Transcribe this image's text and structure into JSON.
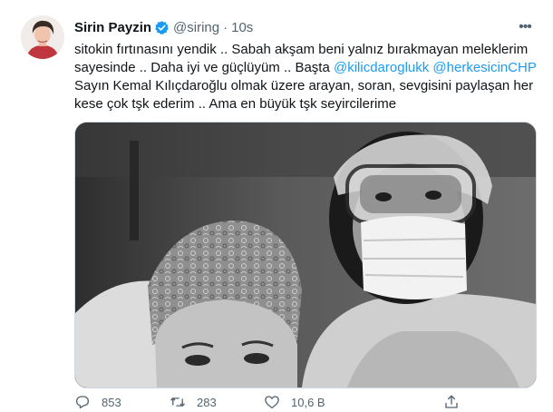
{
  "tweet": {
    "author": {
      "name": "Sirin Payzin",
      "handle": "@siring",
      "avatar_icon": "profile-photo",
      "verified_icon": "verified-badge-icon"
    },
    "dot": "·",
    "time": "10s",
    "more_icon": "more-icon",
    "text": {
      "p1": "sitokin fırtınasını yendik .. Sabah akşam beni yalnız bırakmayan meleklerim sayesinde .. Daha iyi ve güçlüyüm ..  Başta ",
      "mention1": "@kilicdaroglukk",
      "space": " ",
      "mention2": "@herkesicinCHP",
      "p2": "Sayın  Kemal Kılıçdaroğlu olmak üzere arayan, soran, sevgisini paylaşan her kese çok tşk ederim .. Ama en büyük tşk seyircilerime"
    },
    "media": {
      "kind": "black-and-white selfie photo"
    },
    "actions": {
      "reply": {
        "icon": "reply-icon",
        "count": "853"
      },
      "retweet": {
        "icon": "retweet-icon",
        "count": "283"
      },
      "like": {
        "icon": "like-icon",
        "count": "10,6 B"
      },
      "share": {
        "icon": "share-icon"
      }
    },
    "colors": {
      "link": "#1d9bf0",
      "verified": "#1d9bf0",
      "muted": "#536471",
      "text": "#0f1419"
    }
  }
}
